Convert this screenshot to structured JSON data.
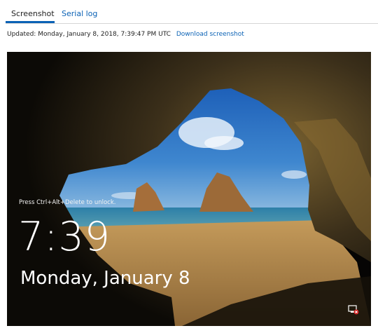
{
  "tabs": [
    {
      "label": "Screenshot",
      "active": true
    },
    {
      "label": "Serial log",
      "active": false
    }
  ],
  "updated": {
    "text": "Updated: Monday, January 8, 2018, 7:39:47 PM UTC",
    "download_label": "Download screenshot"
  },
  "lock_screen": {
    "hint": "Press Ctrl+Alt+Delete to unlock.",
    "time": "7:39",
    "date": "Monday, January 8",
    "network_icon": "network-disconnected-icon"
  },
  "colors": {
    "link": "#0b62b5",
    "sky": "#2f78c8",
    "sea": "#2a6e9a",
    "sand": "#b88a4e",
    "cave": "#2a2217"
  }
}
